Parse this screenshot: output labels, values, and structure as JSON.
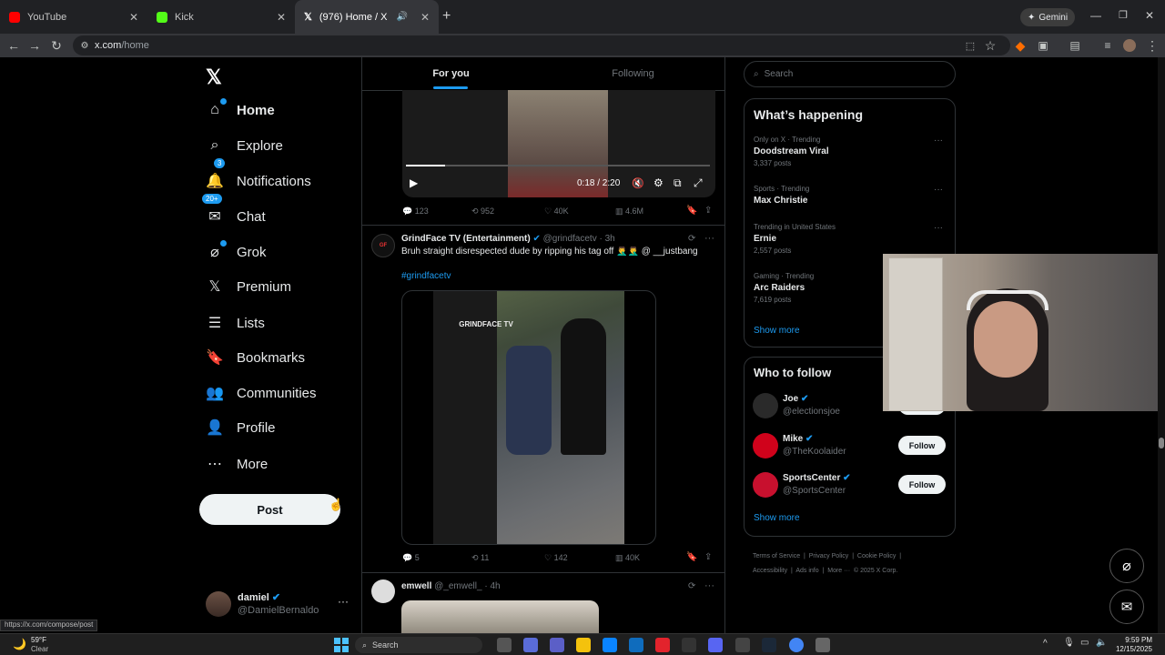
{
  "browser": {
    "tabs": [
      {
        "title": "YouTube",
        "color": "#ff0000"
      },
      {
        "title": "Kick",
        "color": "#53fc18"
      },
      {
        "title": "(976) Home / X",
        "color": "#ffffff"
      }
    ],
    "gemini_label": "Gemini",
    "url_domain": "x.com",
    "url_path": "/home",
    "status_link": "https://x.com/compose/post"
  },
  "nav": {
    "items": [
      {
        "label": "Home",
        "icon": "home-icon"
      },
      {
        "label": "Explore",
        "icon": "search-icon"
      },
      {
        "label": "Notifications",
        "icon": "bell-icon",
        "badge": "3"
      },
      {
        "label": "Chat",
        "icon": "mail-icon",
        "badge": "20+"
      },
      {
        "label": "Grok",
        "icon": "grok-icon"
      },
      {
        "label": "Premium",
        "icon": "x-icon"
      },
      {
        "label": "Lists",
        "icon": "list-icon"
      },
      {
        "label": "Bookmarks",
        "icon": "bookmark-icon"
      },
      {
        "label": "Communities",
        "icon": "people-icon"
      },
      {
        "label": "Profile",
        "icon": "person-icon"
      },
      {
        "label": "More",
        "icon": "more-circle-icon"
      }
    ],
    "post_label": "Post",
    "account": {
      "name": "damiel",
      "handle": "@DamielBernaldo"
    }
  },
  "feed": {
    "tabs": [
      "For you",
      "Following"
    ],
    "video": {
      "time": "0:18 / 2:20",
      "progress": 0.13
    },
    "post1_stats": {
      "replies": "123",
      "reposts": "952",
      "likes": "40K",
      "views": "4.6M"
    },
    "post2": {
      "author": "GrindFace TV (Entertainment)",
      "handle": "@grindfacetv",
      "time": "3h",
      "text": "Bruh straight disrespected dude by ripping his tag off 🤦‍♂️🤦‍♂️ @ __justbang",
      "hashtag": "#grindfacetv",
      "watermark": "GRINDFACE TV",
      "stats": {
        "replies": "5",
        "reposts": "11",
        "likes": "142",
        "views": "40K"
      }
    },
    "post3": {
      "author": "emwell",
      "handle": "@_emwell_",
      "time": "4h"
    }
  },
  "right": {
    "search_placeholder": "Search",
    "happening_title": "What’s happening",
    "trends": [
      {
        "meta": "Only on X · Trending",
        "title": "Doodstream Viral",
        "count": "3,337 posts"
      },
      {
        "meta": "Sports · Trending",
        "title": "Max Christie",
        "count": ""
      },
      {
        "meta": "Trending in United States",
        "title": "Ernie",
        "count": "2,557 posts"
      },
      {
        "meta": "Gaming · Trending",
        "title": "Arc Raiders",
        "count": "7,619 posts"
      }
    ],
    "show_more": "Show more",
    "who_title": "Who to follow",
    "follow": [
      {
        "name": "Joe",
        "handle": "@electionsjoe"
      },
      {
        "name": "Mike",
        "handle": "@TheKoolaider"
      },
      {
        "name": "SportsCenter",
        "handle": "@SportsCenter"
      }
    ],
    "follow_label": "Follow",
    "footer": [
      "Terms of Service",
      "Privacy Policy",
      "Cookie Policy",
      "Accessibility",
      "Ads info",
      "More ···",
      "© 2025 X Corp."
    ]
  },
  "taskbar": {
    "temp": "59°F",
    "weather": "Clear",
    "search": "Search",
    "time": "9:59 PM",
    "date": "12/15/2025"
  }
}
